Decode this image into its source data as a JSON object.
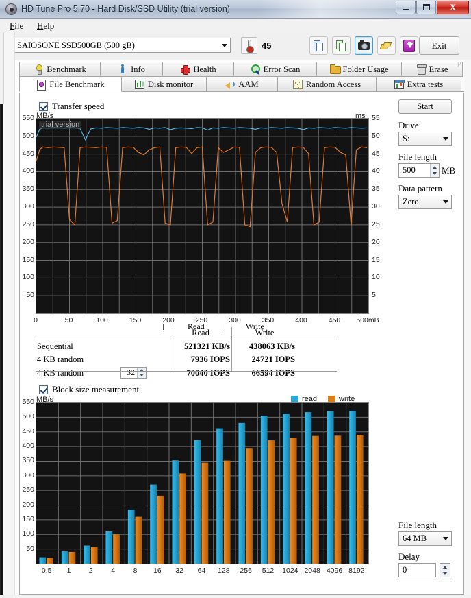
{
  "window": {
    "title": "HD Tune Pro 5.70 - Hard Disk/SSD Utility (trial version)",
    "minimize_label": "",
    "maximize_label": "",
    "close_label": "X",
    "app_icon": "hdtune-disc-icon"
  },
  "menu": {
    "items": [
      {
        "label": "File",
        "accel": "F"
      },
      {
        "label": "Help",
        "accel": "H"
      }
    ],
    "ghost_text": "File   Help"
  },
  "toolbar": {
    "drive_value": "SAIOSONE SSD500GB (500 gB)",
    "temperature": "45°C",
    "temperature_display": "45",
    "buttons": [
      {
        "name": "copy-info-button",
        "icon": "copy-blue-icon"
      },
      {
        "name": "copy-excel-button",
        "icon": "copy-green-icon"
      },
      {
        "name": "screenshot-button",
        "icon": "camera-icon",
        "selected": true
      },
      {
        "name": "tags-button",
        "icon": "tags-icon"
      },
      {
        "name": "download-button",
        "icon": "download-arrow-icon"
      }
    ],
    "exit_label": "Exit"
  },
  "tabs": {
    "row1": [
      {
        "label": "Benchmark",
        "icon": "bulb-icon",
        "active": false
      },
      {
        "label": "Info",
        "icon": "info-icon",
        "active": false
      },
      {
        "label": "Health",
        "icon": "health-cross-icon",
        "active": false
      },
      {
        "label": "Error Scan",
        "icon": "magnifier-icon",
        "active": false
      },
      {
        "label": "Folder Usage",
        "icon": "folder-icon",
        "active": false
      },
      {
        "label": "Erase",
        "icon": "trash-icon",
        "active": false
      }
    ],
    "row2": [
      {
        "label": "File Benchmark",
        "icon": "file-benchmark-icon",
        "active": true
      },
      {
        "label": "Disk monitor",
        "icon": "bar-chart-icon",
        "active": false
      },
      {
        "label": "AAM",
        "icon": "speaker-icon",
        "active": false
      },
      {
        "label": "Random Access",
        "icon": "random-dots-icon",
        "active": false
      },
      {
        "label": "Extra tests",
        "icon": "extra-tests-icon",
        "active": false
      }
    ]
  },
  "transfer_panel": {
    "checkbox_label": "Transfer speed",
    "checked": true,
    "trial_watermark": "trial version",
    "y_unit_left": "MB/s",
    "y_unit_right": "ms",
    "x_end_label": "500mB",
    "marker_read": "Read",
    "marker_write": "Write"
  },
  "controls_top": {
    "start_label": "Start",
    "drive_label": "Drive",
    "drive_value": "S:",
    "file_length_label": "File length",
    "file_length_value": "500",
    "file_length_unit": "MB",
    "data_pattern_label": "Data pattern",
    "data_pattern_value": "Zero"
  },
  "results": {
    "col_read": "Read",
    "col_write": "Write",
    "rows": [
      {
        "label": "Sequential",
        "read": "521321 KB/s",
        "write": "438063 KB/s",
        "spinner": null
      },
      {
        "label": "4 KB random",
        "read": "7936 IOPS",
        "write": "24721 IOPS",
        "spinner": null
      },
      {
        "label": "4 KB random",
        "read": "70040 IOPS",
        "write": "66594 IOPS",
        "spinner": "32"
      }
    ]
  },
  "block_panel": {
    "checkbox_label": "Block size measurement",
    "checked": true,
    "y_unit": "MB/s",
    "legend": [
      {
        "label": "read",
        "color": "#29a8d8"
      },
      {
        "label": "write",
        "color": "#e07c16"
      }
    ]
  },
  "controls_bottom": {
    "file_length_label": "File length",
    "file_length_value": "64 MB",
    "delay_label": "Delay",
    "delay_value": "0"
  },
  "colors": {
    "read_line": "#58b4e0",
    "write_line": "#e07a32",
    "read_bar": "#29a8d8",
    "write_bar": "#e07c16",
    "graph_bg": "#131313",
    "grid": "#6d6d6d",
    "accent_select": "#3c9ed6"
  },
  "chart_data": [
    {
      "type": "line",
      "id": "transfer-speed-graph",
      "title": "Transfer speed",
      "xlabel": "",
      "ylabel": "MB/s",
      "y2label": "ms",
      "xlim": [
        0,
        500
      ],
      "ylim": [
        0,
        550
      ],
      "y2lim": [
        0,
        55
      ],
      "xticks": [
        0,
        50,
        100,
        150,
        200,
        250,
        300,
        350,
        400,
        450,
        500
      ],
      "xticklabels": [
        "0",
        "50",
        "100",
        "150",
        "200",
        "250",
        "300",
        "350",
        "400",
        "450",
        "500mB"
      ],
      "yticks": [
        50,
        100,
        150,
        200,
        250,
        300,
        350,
        400,
        450,
        500,
        550
      ],
      "y2ticks": [
        5,
        10,
        15,
        20,
        25,
        30,
        35,
        40,
        45,
        50,
        55
      ],
      "grid": true,
      "annotations": [
        "trial version",
        "Read",
        "Write"
      ],
      "series": [
        {
          "name": "read",
          "color": "#58b4e0",
          "x": [
            0,
            5,
            10,
            18,
            26,
            34,
            42,
            50,
            58,
            66,
            74,
            82,
            90,
            98,
            106,
            114,
            122,
            130,
            138,
            146,
            154,
            162,
            170,
            178,
            186,
            194,
            202,
            210,
            218,
            226,
            234,
            242,
            250,
            258,
            266,
            274,
            282,
            290,
            298,
            306,
            314,
            322,
            330,
            338,
            346,
            354,
            362,
            370,
            378,
            386,
            394,
            402,
            410,
            418,
            426,
            434,
            442,
            450,
            458,
            466,
            474,
            482,
            490,
            498
          ],
          "values": [
            498,
            520,
            524,
            523,
            525,
            524,
            523,
            525,
            524,
            522,
            490,
            521,
            524,
            523,
            525,
            524,
            523,
            525,
            524,
            523,
            525,
            524,
            520,
            524,
            523,
            525,
            519,
            523,
            524,
            523,
            522,
            525,
            524,
            518,
            524,
            523,
            525,
            524,
            523,
            525,
            524,
            523,
            520,
            524,
            523,
            525,
            524,
            523,
            525,
            524,
            523,
            519,
            524,
            523,
            525,
            524,
            523,
            525,
            524,
            523,
            525,
            524,
            523,
            524
          ]
        },
        {
          "name": "write",
          "color": "#e07a32",
          "x": [
            0,
            5,
            10,
            18,
            26,
            34,
            42,
            50,
            58,
            66,
            74,
            82,
            90,
            98,
            106,
            114,
            122,
            130,
            138,
            146,
            154,
            162,
            170,
            178,
            186,
            194,
            202,
            210,
            218,
            226,
            234,
            242,
            250,
            258,
            266,
            274,
            282,
            290,
            298,
            306,
            314,
            322,
            330,
            338,
            346,
            354,
            362,
            370,
            378,
            386,
            394,
            402,
            410,
            418,
            426,
            434,
            442,
            450,
            458,
            466,
            474,
            482,
            490,
            498
          ],
          "values": [
            430,
            463,
            470,
            468,
            470,
            469,
            468,
            265,
            250,
            468,
            470,
            469,
            468,
            470,
            469,
            255,
            262,
            468,
            470,
            469,
            455,
            448,
            462,
            468,
            470,
            255,
            250,
            468,
            470,
            469,
            452,
            468,
            470,
            250,
            258,
            468,
            455,
            462,
            470,
            469,
            250,
            245,
            455,
            468,
            470,
            469,
            455,
            310,
            258,
            468,
            470,
            469,
            452,
            250,
            258,
            468,
            470,
            469,
            455,
            448,
            250,
            462,
            470,
            468
          ]
        }
      ]
    },
    {
      "type": "bar",
      "id": "block-size-measurement-graph",
      "title": "Block size measurement",
      "xlabel": "",
      "ylabel": "MB/s",
      "ylim": [
        0,
        550
      ],
      "yticks": [
        50,
        100,
        150,
        200,
        250,
        300,
        350,
        400,
        450,
        500,
        550
      ],
      "grid": true,
      "legend_position": "top-right",
      "categories": [
        "0.5",
        "1",
        "2",
        "4",
        "8",
        "16",
        "32",
        "64",
        "128",
        "256",
        "512",
        "1024",
        "2048",
        "4096",
        "8192"
      ],
      "series": [
        {
          "name": "read",
          "color": "#29a8d8",
          "values": [
            22,
            42,
            62,
            110,
            185,
            270,
            353,
            422,
            462,
            480,
            505,
            512,
            517,
            520,
            522
          ]
        },
        {
          "name": "write",
          "color": "#e07c16",
          "values": [
            20,
            40,
            57,
            100,
            160,
            232,
            308,
            345,
            352,
            395,
            421,
            430,
            436,
            437,
            440
          ]
        }
      ]
    }
  ]
}
